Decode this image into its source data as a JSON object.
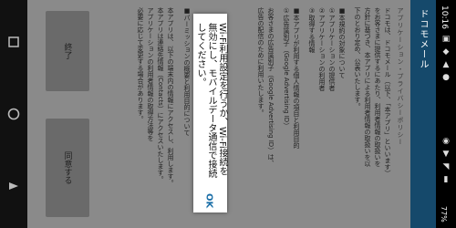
{
  "status_bar": {
    "time": "10:16",
    "battery": "77%",
    "icons": [
      "notification-icon",
      "notification-icon",
      "notification-icon",
      "notification-icon",
      "notification-icon",
      "signal-icon",
      "wifi-icon",
      "battery-icon"
    ]
  },
  "app_bar": {
    "title": "ドコモメール"
  },
  "page": {
    "title": "アプリケーション・プライバシーポリシー",
    "lines": [
      "ドコモは、ドコモメール（以下、「本アプリ」といいます）",
      "をお客さまに提供するにあたり、利用者情報の取扱いを",
      "方針に基づき、本アプリによる利用者情報の取扱いを以",
      "下のとおり定め、公表いたします。",
      "■本規約の対象について",
      "①アプリケーションの提供者",
      "②アプリケーションの利用者",
      "③取得する情報",
      "■本アプリが利用する個人情報の項目と利用目的",
      "①広告識別子（Google Advertising ID）",
      "お客さまの広告識別子（Google Advertising ID）は、",
      "広告の配信のために利用いたします。",
      "■パーミッションの概要と利用目的について",
      "本アプリは、以下の端末内の情報にアクセスし、利用します。",
      "本アプリは連絡先情報（Contacts）にアクセスいたします。",
      "アプリケーションの利用者情報の取得方法等を",
      "必要に応じて変更する場合があります。"
    ]
  },
  "dialog": {
    "message": "Wi-Fi利用設定を行うか、Wi-Fi接続を無効にし、モバイルデータ通信で接続してください。",
    "ok_label": "OK"
  },
  "buttons": {
    "finish_label": "終了",
    "agree_label": "同意する"
  }
}
